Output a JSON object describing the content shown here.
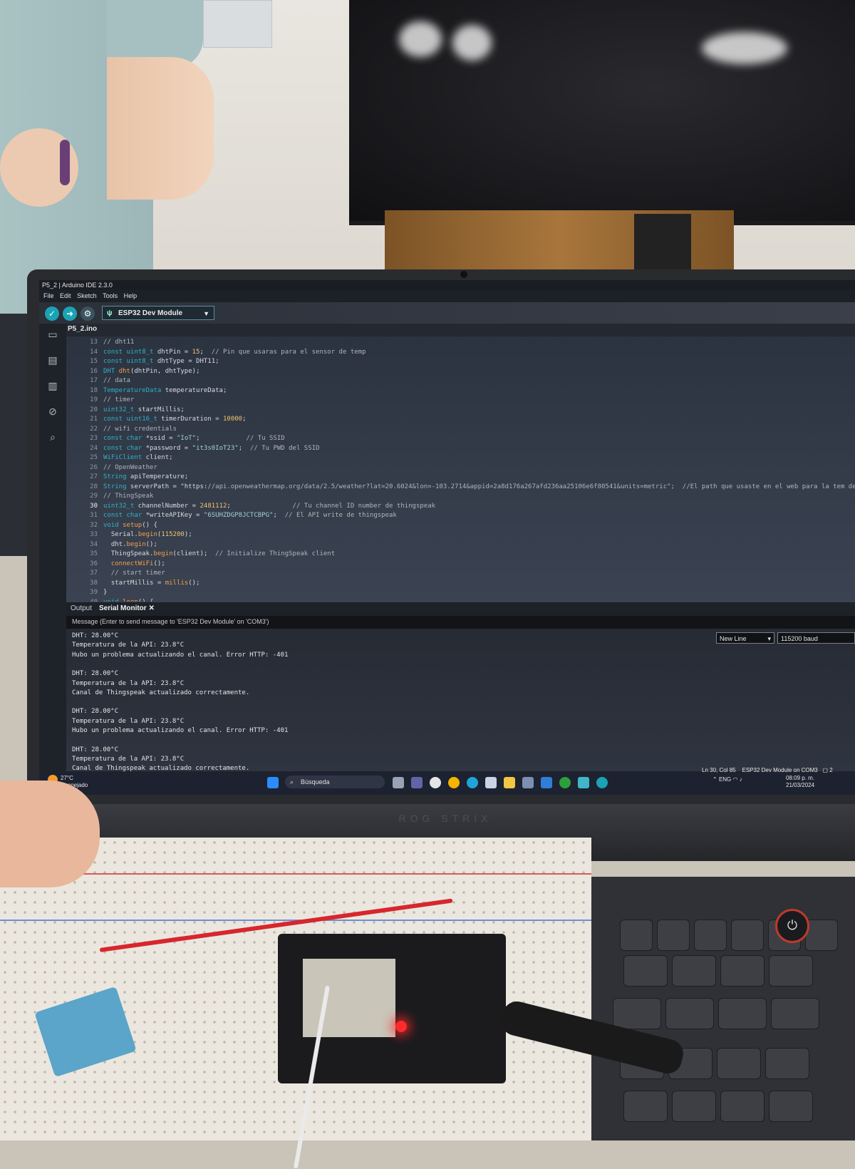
{
  "window": {
    "title": "P5_2 | Arduino IDE 2.3.0",
    "menu": [
      "File",
      "Edit",
      "Sketch",
      "Tools",
      "Help"
    ]
  },
  "toolbar": {
    "verify_icon": "check-icon",
    "upload_icon": "arrow-right-icon",
    "debug_icon": "debug-icon",
    "board": "ESP32 Dev Module"
  },
  "editor": {
    "file_tab": "P5_2.ino",
    "lines": [
      {
        "n": "13",
        "text": "// dht11"
      },
      {
        "n": "14",
        "text": "const uint8_t dhtPin = 15;  // Pin que usaras para el sensor de temp"
      },
      {
        "n": "15",
        "text": "const uint8_t dhtType = DHT11;"
      },
      {
        "n": "16",
        "text": "DHT dht(dhtPin, dhtType);"
      },
      {
        "n": "17",
        "text": "// data"
      },
      {
        "n": "18",
        "text": "TemperatureData temperatureData;"
      },
      {
        "n": "19",
        "text": "// timer"
      },
      {
        "n": "20",
        "text": "uint32_t startMillis;"
      },
      {
        "n": "21",
        "text": "const uint16_t timerDuration = 10000;"
      },
      {
        "n": "22",
        "text": "// wifi credentials"
      },
      {
        "n": "23",
        "text": "const char *ssid = \"IoT\";            // Tu SSID"
      },
      {
        "n": "24",
        "text": "const char *password = \"it3s0IoT23\";  // Tu PWD del SSID"
      },
      {
        "n": "25",
        "text": "WiFiClient client;"
      },
      {
        "n": "26",
        "text": "// OpenWeather"
      },
      {
        "n": "27",
        "text": "String apiTemperature;"
      },
      {
        "n": "28",
        "text": "String serverPath = \"https://api.openweathermap.org/data/2.5/weather?lat=20.6024&lon=-103.2714&appid=2a8d176a267afd236aa25106e6f80541&units=metric\";  //El path que usaste en el web para la tem de l"
      },
      {
        "n": "29",
        "text": "// ThingSpeak"
      },
      {
        "n": "30",
        "text": "uint32_t channelNumber = 2481112;                // Tu channel ID number de thingspeak"
      },
      {
        "n": "31",
        "text": "const char *writeAPIKey = \"6SUHZDGP8JCTCBPG\";  // El API write de thingspeak"
      },
      {
        "n": "32",
        "text": "void setup() {"
      },
      {
        "n": "33",
        "text": "  Serial.begin(115200);"
      },
      {
        "n": "34",
        "text": "  dht.begin();"
      },
      {
        "n": "35",
        "text": "  ThingSpeak.begin(client);  // Initialize ThingSpeak client"
      },
      {
        "n": "36",
        "text": "  connectWiFi();"
      },
      {
        "n": "37",
        "text": "  // start timer"
      },
      {
        "n": "38",
        "text": "  startMillis = millis();"
      },
      {
        "n": "39",
        "text": "}"
      },
      {
        "n": "40",
        "text": "void loop() {"
      }
    ]
  },
  "panel": {
    "tabs": [
      "Output",
      "Serial Monitor"
    ],
    "close_icon": "close-icon",
    "message_placeholder": "Message (Enter to send message to 'ESP32 Dev Module' on 'COM3')",
    "line_ending": "New Line",
    "baud": "115200 baud",
    "serial_lines": [
      "DHT: 28.00°C",
      "Temperatura de la API: 23.8°C",
      "Hubo un problema actualizando el canal. Error HTTP: -401",
      "",
      "DHT: 28.00°C",
      "Temperatura de la API: 23.8°C",
      "Canal de Thingspeak actualizado correctamente.",
      "",
      "DHT: 28.00°C",
      "Temperatura de la API: 23.8°C",
      "Hubo un problema actualizando el canal. Error HTTP: -401",
      "",
      "DHT: 28.00°C",
      "Temperatura de la API: 23.8°C",
      "Canal de Thingspeak actualizado correctamente."
    ]
  },
  "statusbar": {
    "position": "Ln 30, Col 85",
    "board_port": "ESP32 Dev Module on COM3",
    "notifications": "2"
  },
  "taskbar": {
    "weather_temp": "27°C",
    "weather_desc": "Despejado",
    "search_placeholder": "Búsqueda",
    "language": "ENG",
    "time": "08:09 p. m.",
    "date": "21/03/2024"
  },
  "laptop": {
    "brand": "ROG STRIX"
  }
}
